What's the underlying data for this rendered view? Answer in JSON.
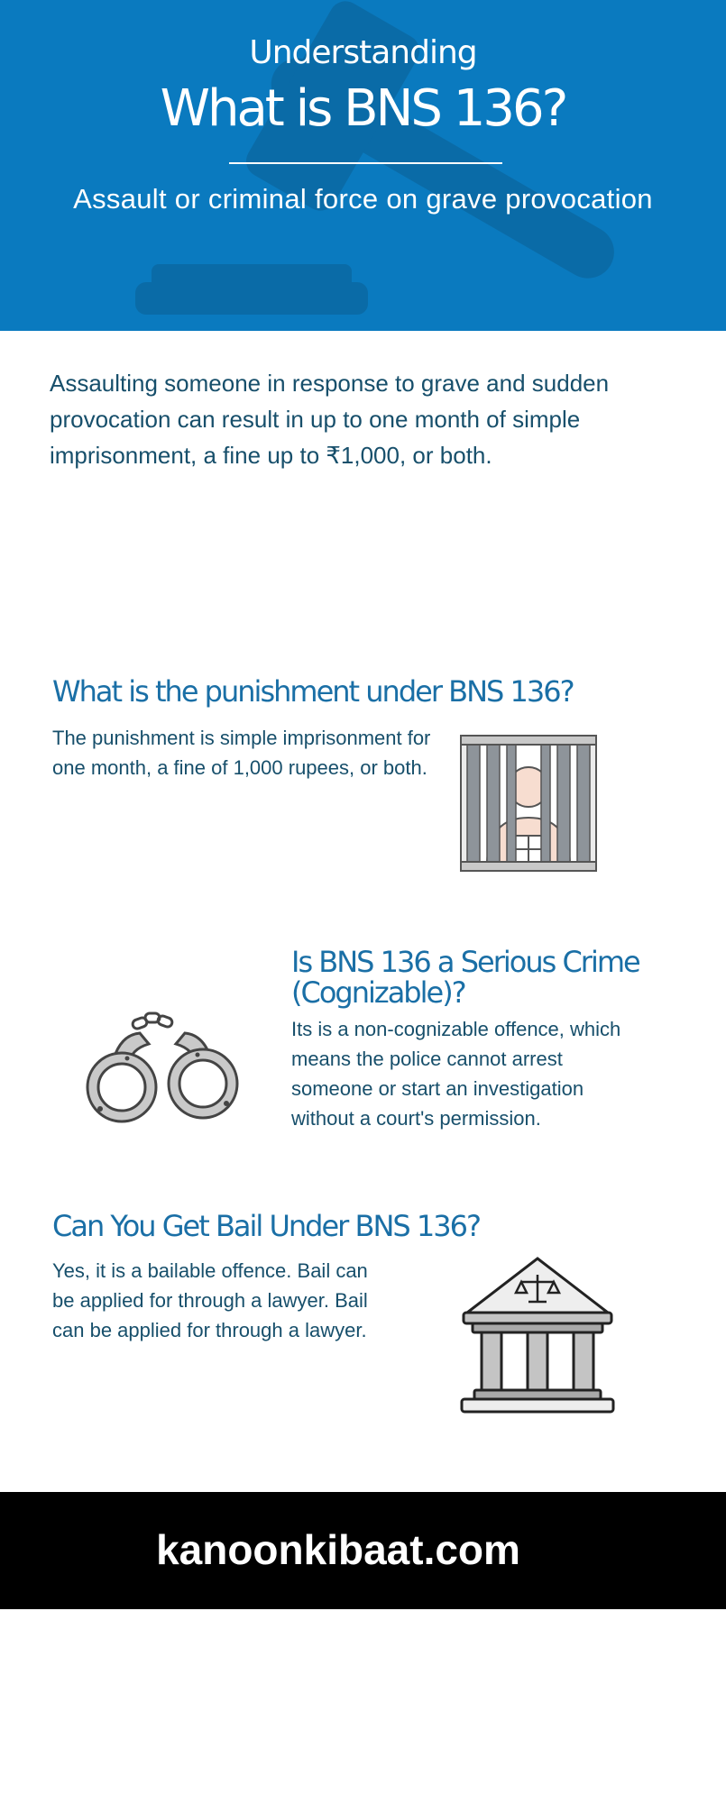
{
  "header": {
    "kicker": "Understanding",
    "title": "What is BNS 136?",
    "subtitle": "Assault or criminal force on grave provocation",
    "background_color": "#0a7abf"
  },
  "intro": {
    "text": "Assaulting someone in response to grave and sudden provocation can result in up to one month of simple imprisonment, a fine up to ₹1,000, or both."
  },
  "sections": [
    {
      "heading": "What is the punishment under BNS 136?",
      "body": "The punishment is simple imprisonment for one month, a fine of 1,000 rupees, or both.",
      "icon": "prisoner-behind-bars-icon"
    },
    {
      "heading_line1": "Is BNS 136 a Serious Crime",
      "heading_line2": "(Cognizable)?",
      "body": "Its is a non-cognizable offence, which means the police cannot arrest someone or start an investigation without a court's permission.",
      "icon": "handcuffs-icon"
    },
    {
      "heading": "Can You Get Bail Under BNS 136?",
      "body": "Yes, it is a bailable offence. Bail can be applied for through a lawyer. Bail can be applied for through a lawyer.",
      "icon": "courthouse-icon"
    }
  ],
  "footer": {
    "text": "kanoonkibaat.com"
  },
  "colors": {
    "heading": "#1a6fa6",
    "body_text": "#174f6b",
    "footer_bg": "#000000"
  }
}
